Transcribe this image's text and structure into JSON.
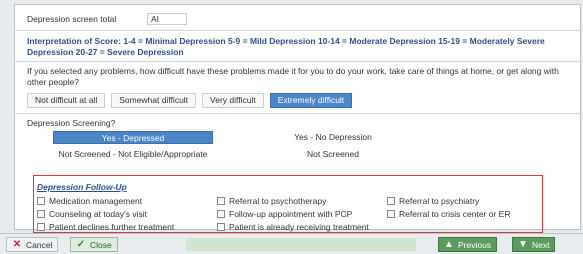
{
  "score": {
    "label": "Depression screen total",
    "value": "AI"
  },
  "interpretation": "Interpretation of Score: 1-4 = Minimal Depression 5-9 = Mild Depression 10-14 = Moderate Depression 15-19 = Moderately Severe Depression 20-27 = Severe Depression",
  "question": "If you selected any problems, how difficult have these problems made it for you to do your work, take care of things at home, or get along with other people?",
  "difficulty_options": [
    {
      "label": "Not difficult at all",
      "selected": false
    },
    {
      "label": "Somewhat difficult",
      "selected": false
    },
    {
      "label": "Very difficult",
      "selected": false
    },
    {
      "label": "Extremely difficult",
      "selected": true
    }
  ],
  "screened": {
    "title": "Depression Screening?",
    "options": [
      {
        "label": "Yes - Depressed",
        "selected": true
      },
      {
        "label": "Yes - No Depression",
        "selected": false
      },
      {
        "label": "Not Screened - Not Eligible/Appropriate",
        "selected": false
      },
      {
        "label": "Not Screened",
        "selected": false
      }
    ]
  },
  "followup": {
    "title": "Depression Follow-Up",
    "items": [
      "Medication management",
      "Referral to psychotherapy",
      "Referral to psychiatry",
      "Counseling at today's visit",
      "Follow-up appointment with PCP",
      "Referral to crisis center or ER",
      "Patient declines further treatment",
      "Patient is already receiving treatment"
    ]
  },
  "bottom": {
    "cancel": "Cancel",
    "close": "Close",
    "previous": "Previous",
    "next": "Next"
  },
  "colors": {
    "selected": "#4a86c8",
    "followup_border": "#d23c3c",
    "heading": "#2f4f8f",
    "nav_green": "#5e9a5e"
  }
}
